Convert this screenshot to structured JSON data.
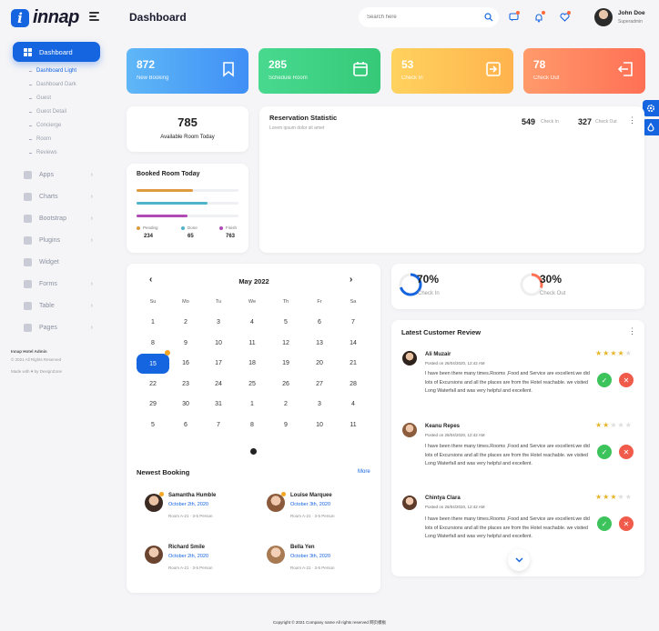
{
  "brand": {
    "logo_letter": "i",
    "name": "innap"
  },
  "sidebar": {
    "active": "Dashboard",
    "subitems": [
      {
        "label": "Dashboard Light",
        "active": true
      },
      {
        "label": "Dashboard Dark"
      },
      {
        "label": "Guest"
      },
      {
        "label": "Guest Detail"
      },
      {
        "label": "Concierge"
      },
      {
        "label": "Room"
      },
      {
        "label": "Reviews"
      }
    ],
    "items": [
      {
        "label": "Apps",
        "icon": "apps-icon"
      },
      {
        "label": "Charts",
        "icon": "chart-icon"
      },
      {
        "label": "Bootstrap",
        "icon": "star-icon"
      },
      {
        "label": "Plugins",
        "icon": "heart-icon"
      },
      {
        "label": "Widget",
        "icon": "widget-icon"
      },
      {
        "label": "Forms",
        "icon": "form-icon"
      },
      {
        "label": "Table",
        "icon": "table-icon"
      },
      {
        "label": "Pages",
        "icon": "pages-icon"
      }
    ],
    "footer_title": "Innap Hotel Admin",
    "footer_copy": "© 2021 All Rights Reserved",
    "footer_made": "Made with ♥ by DexignZone"
  },
  "header": {
    "title": "Dashboard",
    "search_placeholder": "Search here",
    "user_name": "John Doe",
    "user_role": "Superadmin"
  },
  "stats": [
    {
      "value": "872",
      "label": "New Booking",
      "color_from": "#5fb7f7",
      "color_to": "#3f8ff5",
      "icon": "bookmark-icon"
    },
    {
      "value": "285",
      "label": "Schedule Room",
      "color_from": "#48d98f",
      "color_to": "#36c978",
      "icon": "calendar-icon"
    },
    {
      "value": "53",
      "label": "Check In",
      "color_from": "#ffd25e",
      "color_to": "#ffb34d",
      "icon": "login-icon"
    },
    {
      "value": "78",
      "label": "Check Out",
      "color_from": "#ff9a6b",
      "color_to": "#ff7055",
      "icon": "logout-icon"
    }
  ],
  "available": {
    "value": "785",
    "label": "Available Room Today"
  },
  "reservation": {
    "title": "Reservation Statistic",
    "subtitle": "Lorem ipsum dolor sit amet",
    "checkin_value": "549",
    "checkin_label": "Check In",
    "checkout_value": "327",
    "checkout_label": "Check Out"
  },
  "booked": {
    "title": "Booked Room Today",
    "legend": [
      {
        "label": "Pending",
        "value": "234",
        "color": "#e09a3e",
        "fill": 0.55
      },
      {
        "label": "Done",
        "value": "65",
        "color": "#4fb3c9",
        "fill": 0.7
      },
      {
        "label": "Finish",
        "value": "763",
        "color": "#b04bb5",
        "fill": 0.5
      }
    ]
  },
  "calendar": {
    "month": "May 2022",
    "days": [
      "Su",
      "Mo",
      "Tu",
      "We",
      "Th",
      "Fr",
      "Sa"
    ],
    "weeks": [
      [
        "1",
        "2",
        "3",
        "4",
        "5",
        "6",
        "7"
      ],
      [
        "8",
        "9",
        "10",
        "11",
        "12",
        "13",
        "14"
      ],
      [
        "15",
        "16",
        "17",
        "18",
        "19",
        "20",
        "21"
      ],
      [
        "22",
        "23",
        "24",
        "25",
        "26",
        "27",
        "28"
      ],
      [
        "29",
        "30",
        "31",
        "1",
        "2",
        "3",
        "4"
      ],
      [
        "5",
        "6",
        "7",
        "8",
        "9",
        "10",
        "11"
      ]
    ],
    "today": "15"
  },
  "percent": [
    {
      "value": "70%",
      "label": "Check In"
    },
    {
      "value": "30%",
      "label": "Check Out"
    }
  ],
  "newest": {
    "title": "Newest Booking",
    "more": "More",
    "items": [
      {
        "name": "Samantha Humble",
        "date": "October 2th, 2020",
        "room": "Room A-21 · 3-5 Person"
      },
      {
        "name": "Louise Marquee",
        "date": "October 3th, 2020",
        "room": "Room A-21 · 3-5 Person"
      },
      {
        "name": "Richard Smile",
        "date": "October 2th, 2020",
        "room": "Room A-21 · 3-5 Person"
      },
      {
        "name": "Bella Yen",
        "date": "October 3th, 2020",
        "room": "Room A-21 · 3-5 Person"
      }
    ]
  },
  "reviews": {
    "title": "Latest Customer Review",
    "items": [
      {
        "name": "Ali Muzair",
        "date": "Posted on 26/04/2020, 12:42 AM",
        "rating": 4,
        "text": "I have been there many times.Rooms ,Food and Service are excellent.we did lots of Excursions and all the places are from the Hotel reachable. we visited Long Waterfall and was very helpful and excellent."
      },
      {
        "name": "Keanu Repes",
        "date": "Posted on 26/04/2020, 12:42 AM",
        "rating": 2,
        "text": "I have been there many times.Rooms ,Food and Service are excellent.we did lots of Excursions and all the places are from the Hotel reachable. we visited Long Waterfall and was very helpful and excellent."
      },
      {
        "name": "Chintya Clara",
        "date": "Posted on 26/04/2020, 12:42 AM",
        "rating": 3,
        "text": "I have been there many times.Rooms ,Food and Service are excellent.we did lots of Excursions and all the places are from the Hotel reachable. we visited Long Waterfall and was very helpful and excellent."
      }
    ]
  },
  "footer": "Copyright © 2021 Company name All rights reserved 网页模板"
}
